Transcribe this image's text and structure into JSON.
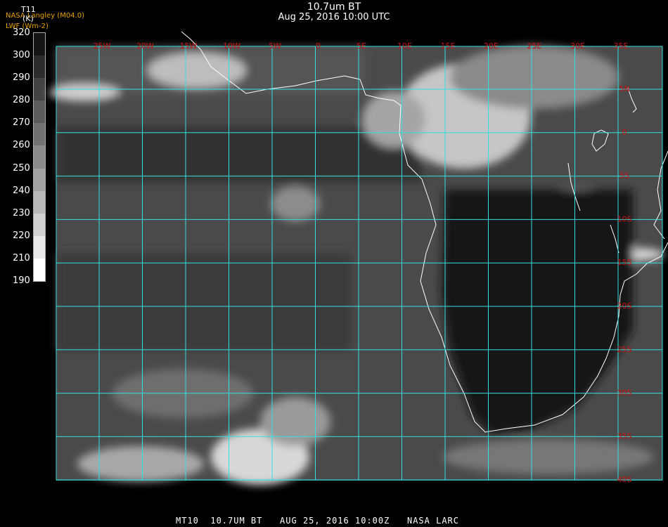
{
  "header": {
    "title": "10.7um BT",
    "datetime": "Aug 25, 2016 10:00 UTC",
    "credit_line1": "NASA Langley (M04.0)",
    "credit_line2": "LWF (Wm-2)"
  },
  "colorbar": {
    "variable": "T11",
    "unit": "(K)",
    "ticks": [
      "320",
      "300",
      "290",
      "280",
      "270",
      "260",
      "250",
      "240",
      "230",
      "220",
      "210",
      "190"
    ]
  },
  "map": {
    "lon_labels": [
      "25W",
      "20W",
      "15W",
      "10W",
      "5W",
      "0",
      "5E",
      "10E",
      "15E",
      "20E",
      "25E",
      "30E",
      "35E"
    ],
    "lat_labels": [
      "5N",
      "0",
      "5S",
      "10S",
      "15S",
      "20S",
      "25S",
      "30S",
      "35S",
      "40S"
    ],
    "grid_color": "#33e0e0",
    "label_color": "#cc1111",
    "coast_color": "#ffffff"
  },
  "footer": {
    "text": "MT10  10.7UM BT   AUG 25, 2016 10:00Z   NASA LARC"
  }
}
